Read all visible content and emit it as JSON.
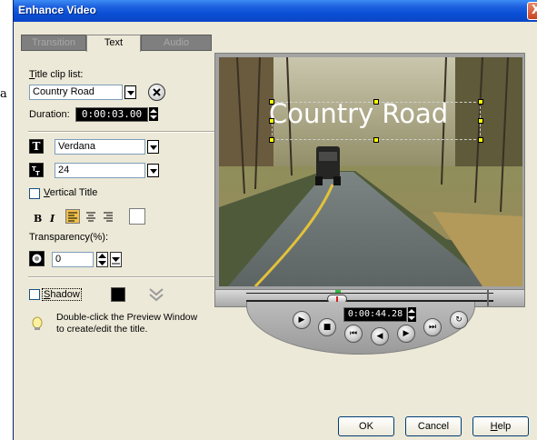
{
  "background_glyph": "a",
  "window": {
    "title": "Enhance Video",
    "close_glyph": "X"
  },
  "tabs": [
    {
      "label": "Transition",
      "active": false
    },
    {
      "label": "Text",
      "active": true
    },
    {
      "label": "Audio",
      "active": false
    }
  ],
  "title_clip_list": {
    "label_u": "T",
    "label_rest": "itle clip list:",
    "value": "Country Road"
  },
  "duration": {
    "label": "Duration:",
    "value": "0:00:03.00"
  },
  "font": {
    "icon_glyph": "T",
    "value": "Verdana"
  },
  "size": {
    "value": "24"
  },
  "vertical_title": {
    "label_u": "V",
    "label_rest": "ertical Title",
    "checked": false
  },
  "format_buttons": {
    "bold": "B",
    "italic": "I"
  },
  "transparency": {
    "label": "Transparency(%):",
    "value": "0"
  },
  "shadow": {
    "label_u": "S",
    "label_rest": "hadow",
    "checked": false,
    "color": "#000000"
  },
  "hint": {
    "text": "Double-click the Preview Window to create/edit the title."
  },
  "preview": {
    "title_text": "Country Road"
  },
  "player": {
    "timecode": "0:00:44.28",
    "progress": 0.29
  },
  "buttons": {
    "ok": "OK",
    "cancel": "Cancel",
    "help_u": "H",
    "help_rest": "elp"
  },
  "colors": {
    "accent": "#0a4fd6",
    "title_text": "#ffffff",
    "handle": "#ffff00"
  }
}
